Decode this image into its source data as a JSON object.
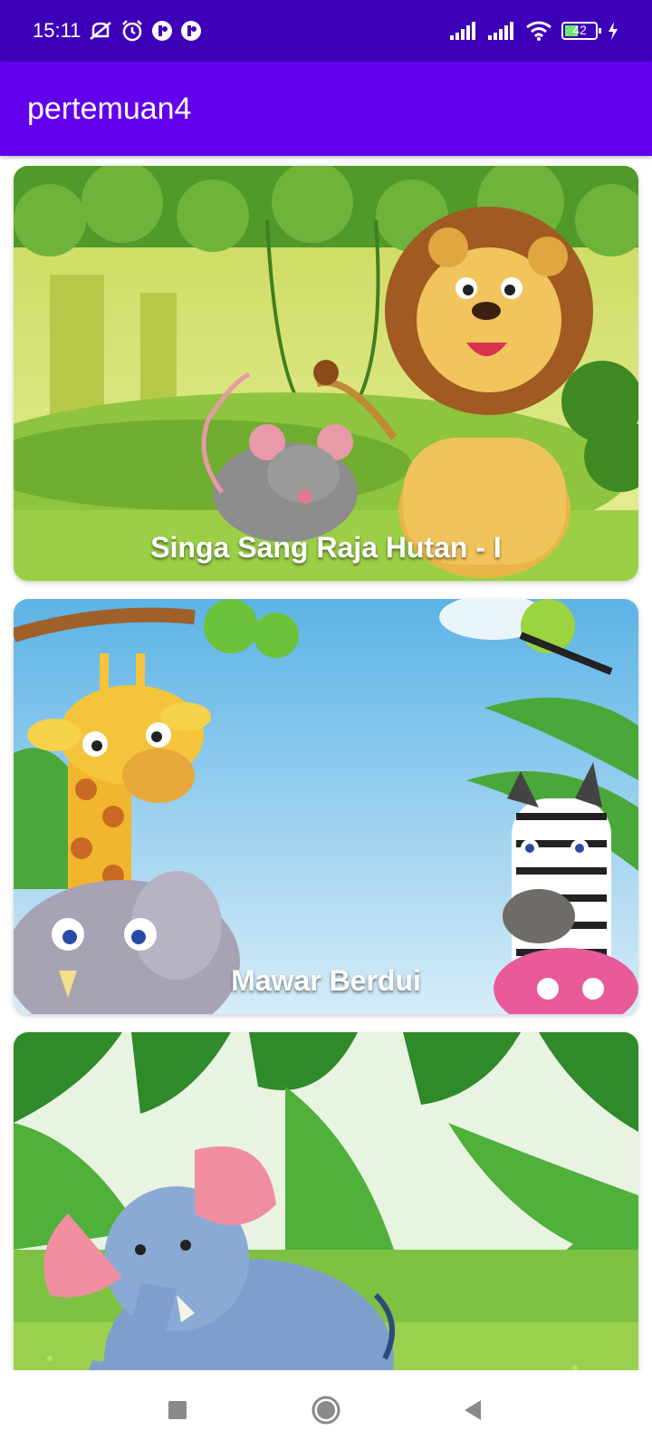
{
  "status_bar": {
    "time": "15:11",
    "battery_level": "42",
    "left_icons": [
      "mute-icon",
      "alarm-icon",
      "app-notification-icon",
      "app-notification-icon"
    ],
    "right_icons": [
      "signal-icon",
      "signal-icon",
      "wifi-icon",
      "battery-icon",
      "charging-icon"
    ]
  },
  "app_bar": {
    "title": "pertemuan4"
  },
  "cards": [
    {
      "caption": "Singa Sang Raja Hutan - I",
      "image": "lion-and-mouse-jungle-illustration"
    },
    {
      "caption": "Mawar Berdui",
      "image": "giraffe-elephant-zebra-illustration"
    },
    {
      "caption": "",
      "image": "elephant-jungle-illustration"
    }
  ],
  "nav_bar": {
    "buttons": [
      "recents-button",
      "home-button",
      "back-button"
    ]
  },
  "colors": {
    "status_bar": "#3d00b8",
    "app_bar": "#6200ee",
    "app_bar_text": "#ffffff"
  }
}
